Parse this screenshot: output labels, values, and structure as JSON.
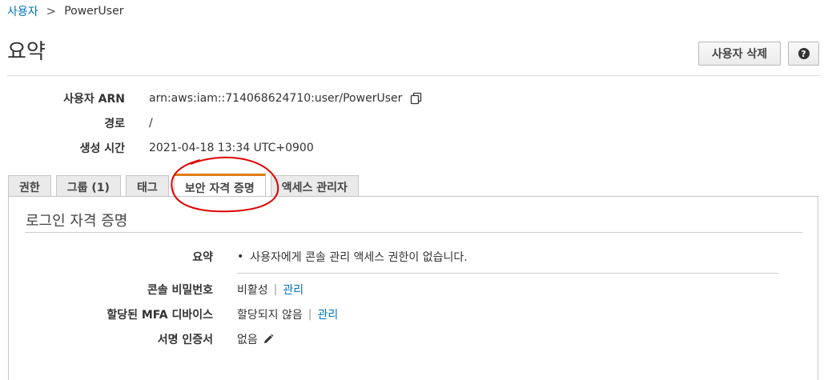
{
  "breadcrumb": {
    "parent": "사용자",
    "separator": ">",
    "current": "PowerUser"
  },
  "page_title": "요약",
  "header_buttons": {
    "delete_label": "사용자 삭제",
    "help_icon": "question-circle-icon"
  },
  "user_info": [
    {
      "label": "사용자 ARN",
      "value": "arn:aws:iam::714068624710:user/PowerUser",
      "icon": "copy-icon"
    },
    {
      "label": "경로",
      "value": "/"
    },
    {
      "label": "생성 시간",
      "value": "2021-04-18 13:34 UTC+0900"
    }
  ],
  "tabs": [
    {
      "label": "권한",
      "active": false
    },
    {
      "label": "그룹 (1)",
      "active": false
    },
    {
      "label": "태그",
      "active": false
    },
    {
      "label": "보안 자격 증명",
      "active": true
    },
    {
      "label": "액세스 관리자",
      "active": false
    }
  ],
  "credentials": {
    "section_title": "로그인 자격 증명",
    "summary_label": "요약",
    "summary_bullet": "•",
    "summary_text": "사용자에게 콘솔 관리 액세스 권한이 없습니다.",
    "console_password": {
      "label": "콘솔 비밀번호",
      "status": "비활성",
      "separator": "|",
      "action": "관리"
    },
    "mfa_device": {
      "label": "할당된 MFA 디바이스",
      "status": "할당되지 않음",
      "separator": "|",
      "action": "관리"
    },
    "signing_cert": {
      "label": "서명 인증서",
      "value": "없음",
      "icon": "pencil-icon"
    }
  },
  "colors": {
    "link": "#0073bb",
    "active_tab_accent": "#e07c14",
    "annotation": "#e00000"
  }
}
